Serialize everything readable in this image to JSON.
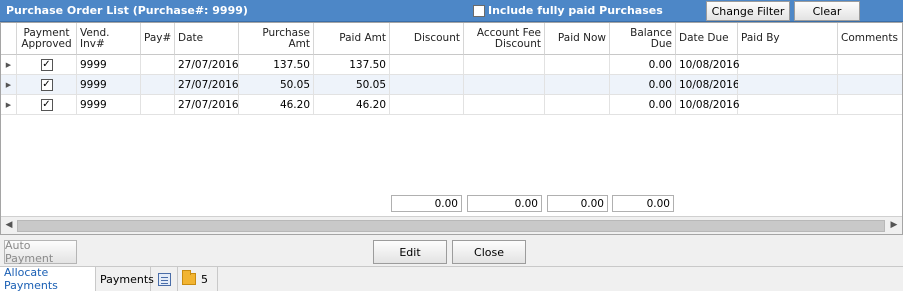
{
  "header": {
    "title": "Purchase Order List (Purchase#: 9999)",
    "include_paid_label": "Include fully paid Purchases",
    "include_paid_checked": false,
    "change_filter_label": "Change Filter",
    "clear_label": "Clear"
  },
  "grid": {
    "columns": [
      "Payment Approved",
      "Vend. Inv#",
      "Pay#",
      "Date",
      "Purchase Amt",
      "Paid Amt",
      "Discount",
      "Account Fee Discount",
      "Paid Now",
      "Balance Due",
      "Date Due",
      "Paid By",
      "Comments"
    ],
    "rows": [
      {
        "approved": true,
        "vend_inv": "9999",
        "pay": "",
        "date": "27/07/2016",
        "purchase_amt": "137.50",
        "paid_amt": "137.50",
        "discount": "",
        "account_fee_discount": "",
        "paid_now": "",
        "balance_due": "0.00",
        "date_due": "10/08/2016",
        "paid_by": "",
        "comments": ""
      },
      {
        "approved": true,
        "vend_inv": "9999",
        "pay": "",
        "date": "27/07/2016",
        "purchase_amt": "50.05",
        "paid_amt": "50.05",
        "discount": "",
        "account_fee_discount": "",
        "paid_now": "",
        "balance_due": "0.00",
        "date_due": "10/08/2016",
        "paid_by": "",
        "comments": ""
      },
      {
        "approved": true,
        "vend_inv": "9999",
        "pay": "",
        "date": "27/07/2016",
        "purchase_amt": "46.20",
        "paid_amt": "46.20",
        "discount": "",
        "account_fee_discount": "",
        "paid_now": "",
        "balance_due": "0.00",
        "date_due": "10/08/2016",
        "paid_by": "",
        "comments": ""
      }
    ],
    "totals": {
      "discount": "0.00",
      "account_fee_discount": "0.00",
      "paid_now": "0.00",
      "balance_due": "0.00"
    }
  },
  "buttons": {
    "auto_payment": "Auto Payment",
    "edit": "Edit",
    "close": "Close"
  },
  "tabs": {
    "allocate_payments": "Allocate Payments",
    "payments": "Payments",
    "attachments_count": "5"
  },
  "icons": [
    "expand-arrow-icon",
    "checkbox-icon",
    "document-icon",
    "folder-icon",
    "scroll-left-icon",
    "scroll-right-icon"
  ],
  "colors": {
    "header_bg": "#4d87c7",
    "alt_row": "#eef3fa",
    "active_tab_text": "#1a5fb4"
  }
}
